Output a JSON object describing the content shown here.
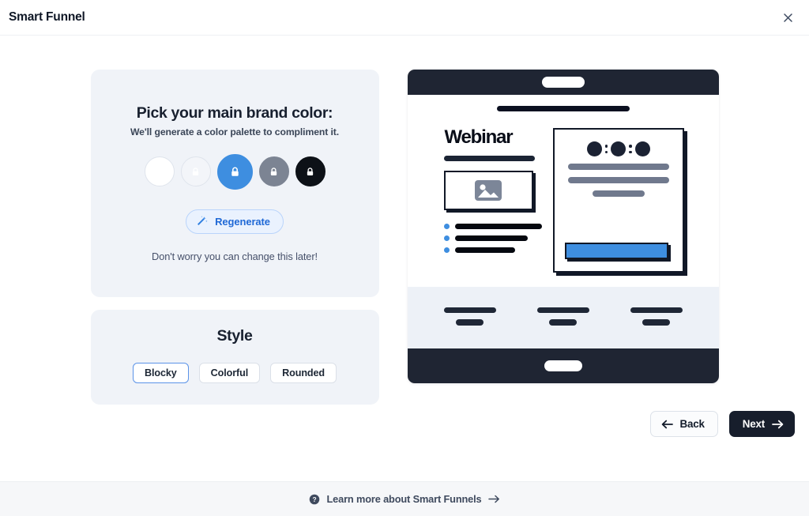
{
  "header": {
    "title": "Smart Funnel",
    "close_icon": "close-icon"
  },
  "brand_panel": {
    "title": "Pick your main brand color:",
    "subtitle": "We'll generate a color palette to compliment it.",
    "hint": "Don't worry you can change this later!",
    "regenerate_label": "Regenerate",
    "regenerate_icon": "magic-wand-icon",
    "swatches": [
      {
        "name": "swatch-white",
        "color": "#ffffff",
        "border": "#dfe4ec",
        "locked": false,
        "selected": false,
        "lock_color": "#ffffff"
      },
      {
        "name": "swatch-off-white",
        "color": "#f3f5f9",
        "border": "#dfe4ec",
        "locked": true,
        "selected": false,
        "lock_color": "#ffffff"
      },
      {
        "name": "swatch-blue",
        "color": "#3e8ee0",
        "border": "#3e8ee0",
        "locked": true,
        "selected": true,
        "lock_color": "#ffffff"
      },
      {
        "name": "swatch-gray",
        "color": "#7c8493",
        "border": "#7c8493",
        "locked": true,
        "selected": false,
        "lock_color": "#ffffff"
      },
      {
        "name": "swatch-black",
        "color": "#0d1117",
        "border": "#0d1117",
        "locked": true,
        "selected": false,
        "lock_color": "#ffffff"
      }
    ]
  },
  "style_panel": {
    "title": "Style",
    "options": [
      {
        "label": "Blocky",
        "selected": true
      },
      {
        "label": "Colorful",
        "selected": false
      },
      {
        "label": "Rounded",
        "selected": false
      }
    ]
  },
  "preview": {
    "headline": "Webinar",
    "image_icon": "image-placeholder-icon",
    "colors": {
      "navbar": "#1f2533",
      "accent": "#3e8ee0",
      "ink": "#111827",
      "features_bg": "#edf1f7"
    },
    "bullets": [
      110,
      92,
      76
    ],
    "form_lines": [
      128,
      128,
      66
    ],
    "features": 3,
    "timer_segments": 3
  },
  "footer_nav": {
    "back_label": "Back",
    "back_icon": "arrow-left-icon",
    "next_label": "Next",
    "next_icon": "arrow-right-icon"
  },
  "page_footer": {
    "help_icon": "question-circle-icon",
    "learn_label": "Learn more about Smart Funnels",
    "learn_arrow_icon": "arrow-right-icon"
  }
}
